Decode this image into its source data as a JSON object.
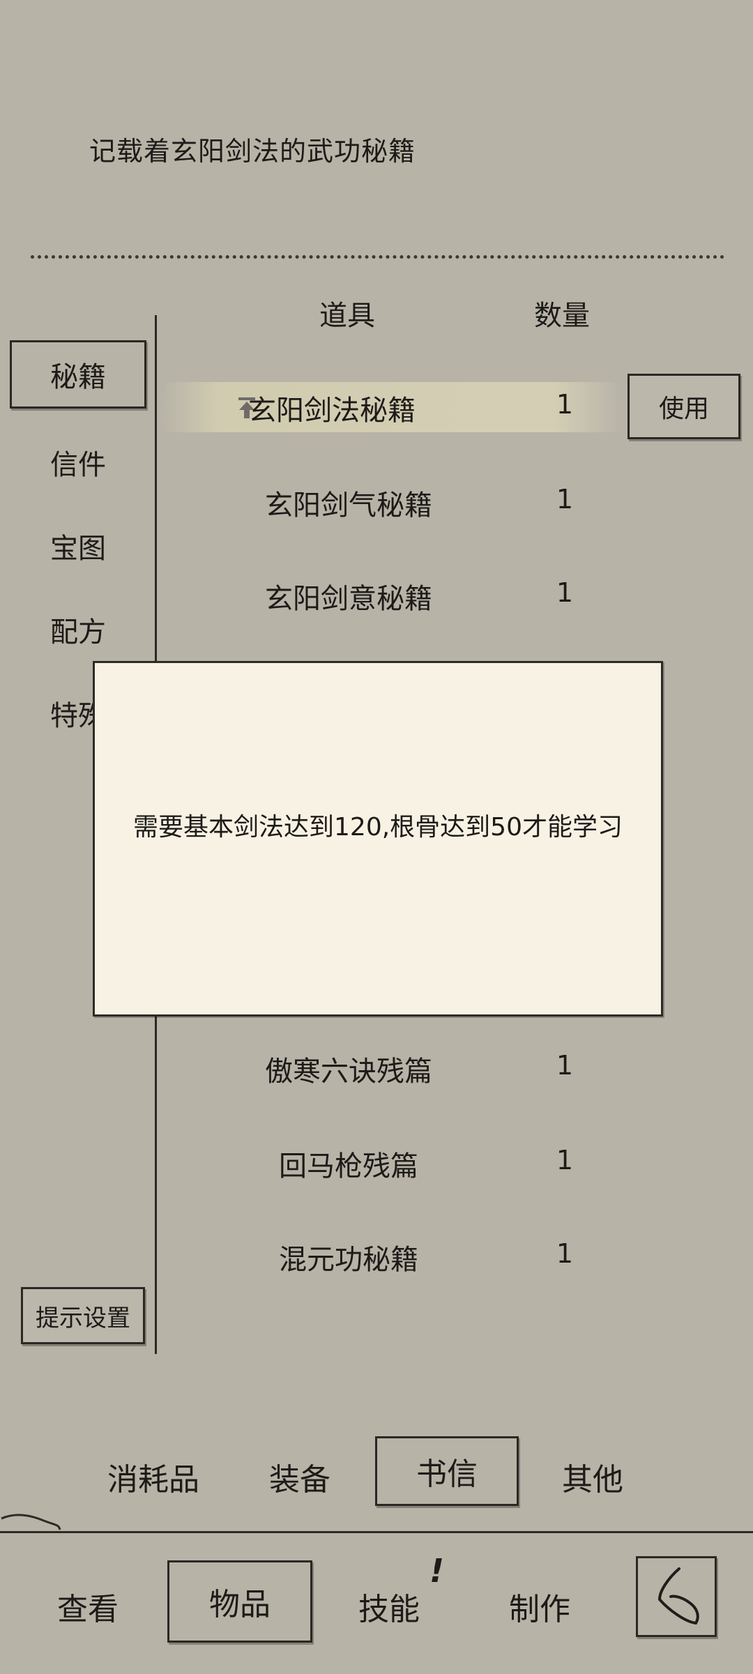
{
  "description": "记载着玄阳剑法的武功秘籍",
  "table_header": {
    "item": "道具",
    "quantity": "数量"
  },
  "categories": [
    "秘籍",
    "信件",
    "宝图",
    "配方",
    "特殊"
  ],
  "items": [
    {
      "name": "玄阳剑法秘籍",
      "quantity": "1",
      "selected": true
    },
    {
      "name": "玄阳剑气秘籍",
      "quantity": "1"
    },
    {
      "name": "玄阳剑意秘籍",
      "quantity": "1"
    },
    {
      "name": "傲寒六诀残篇",
      "quantity": "1"
    },
    {
      "name": "回马枪残篇",
      "quantity": "1"
    },
    {
      "name": "混元功秘籍",
      "quantity": "1"
    }
  ],
  "use_button": "使用",
  "tooltip": "需要基本剑法达到120,根骨达到50才能学习",
  "hint_settings": "提示设置",
  "item_tabs": [
    "消耗品",
    "装备",
    "书信",
    "其他"
  ],
  "bottom_nav": [
    "查看",
    "物品",
    "技能",
    "制作"
  ],
  "skill_alert": "!",
  "icons": {
    "pin": "pin-top-icon",
    "back": "back-arrow-icon"
  }
}
